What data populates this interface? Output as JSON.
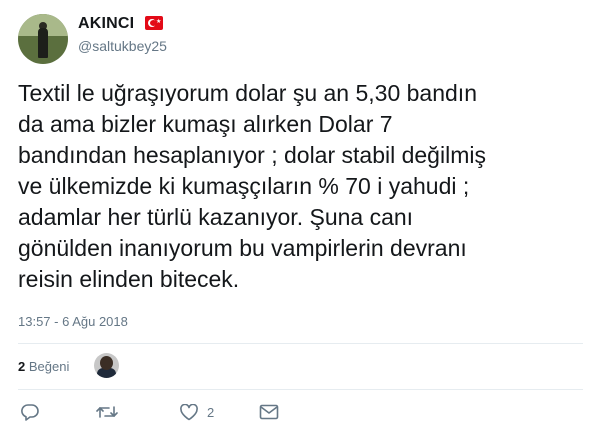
{
  "user": {
    "name": "AKINCI",
    "handle": "@saltukbey25",
    "flag_icon": "turkey-flag-icon"
  },
  "tweet": {
    "text": "Textil le uğraşıyorum dolar şu an 5,30 bandın\nda ama bizler kumaşı alırken Dolar 7\nbandından hesaplanıyor ; dolar stabil değilmiş\nve ülkemizde ki kumaşçıların % 70 i yahudi ;\nadamlar her türlü kazanıyor. Şuna canı\ngönülden inanıyorum bu vampirlerin devranı\nreisin elinden bitecek.",
    "timestamp": "13:57 - 6 Ağu 2018"
  },
  "likes": {
    "count": "2",
    "label": "Beğeni"
  },
  "actions": {
    "reply_icon": "reply-icon",
    "retweet_icon": "retweet-icon",
    "like_icon": "heart-icon",
    "like_count": "2",
    "dm_icon": "envelope-icon"
  },
  "colors": {
    "text": "#14171a",
    "secondary": "#657786",
    "divider": "#e6ecf0",
    "flag_red": "#e30a17"
  }
}
